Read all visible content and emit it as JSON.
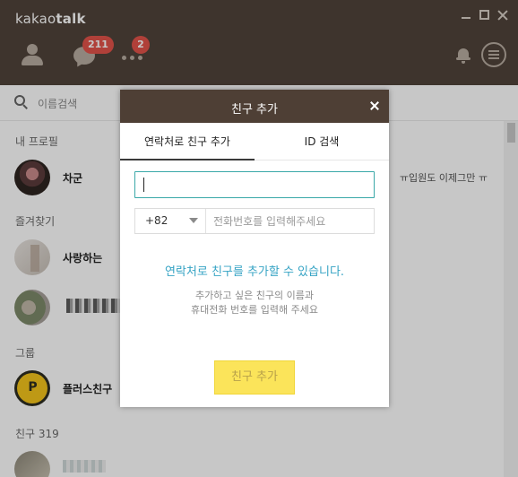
{
  "app": {
    "logo_light": "kakao",
    "logo_bold": "talk"
  },
  "nav": {
    "chat_badge": "211",
    "more_badge": "2"
  },
  "search": {
    "placeholder": "이름검색"
  },
  "sections": {
    "my_profile": "내 프로필",
    "favorites": "즐겨찾기",
    "groups": "그룹",
    "friends": "친구 319"
  },
  "rows": {
    "me_name": "차군",
    "me_status": "ㅠ입원도 이제그만 ㅠ",
    "fav1_name": "사랑하는",
    "group1_name": "플러스친구"
  },
  "modal": {
    "title": "친구 추가",
    "tab_contact": "연락처로 친구 추가",
    "tab_id": "ID 검색",
    "name_value": "",
    "country_code": "+82",
    "phone_placeholder": "전화번호를 입력해주세요",
    "info_main": "연락처로 친구를 추가할 수 있습니다.",
    "info_sub_1": "추가하고 싶은 친구의 이름과",
    "info_sub_2": "휴대전화 번호를 입력해 주세요",
    "add_button": "친구 추가"
  },
  "colors": {
    "header_brown": "#50433a",
    "modal_header": "#4e3f35",
    "badge_red": "#e2534a",
    "accent_teal": "#3aa8a8",
    "info_blue": "#35a3c4",
    "button_yellow": "#fbe45a"
  }
}
